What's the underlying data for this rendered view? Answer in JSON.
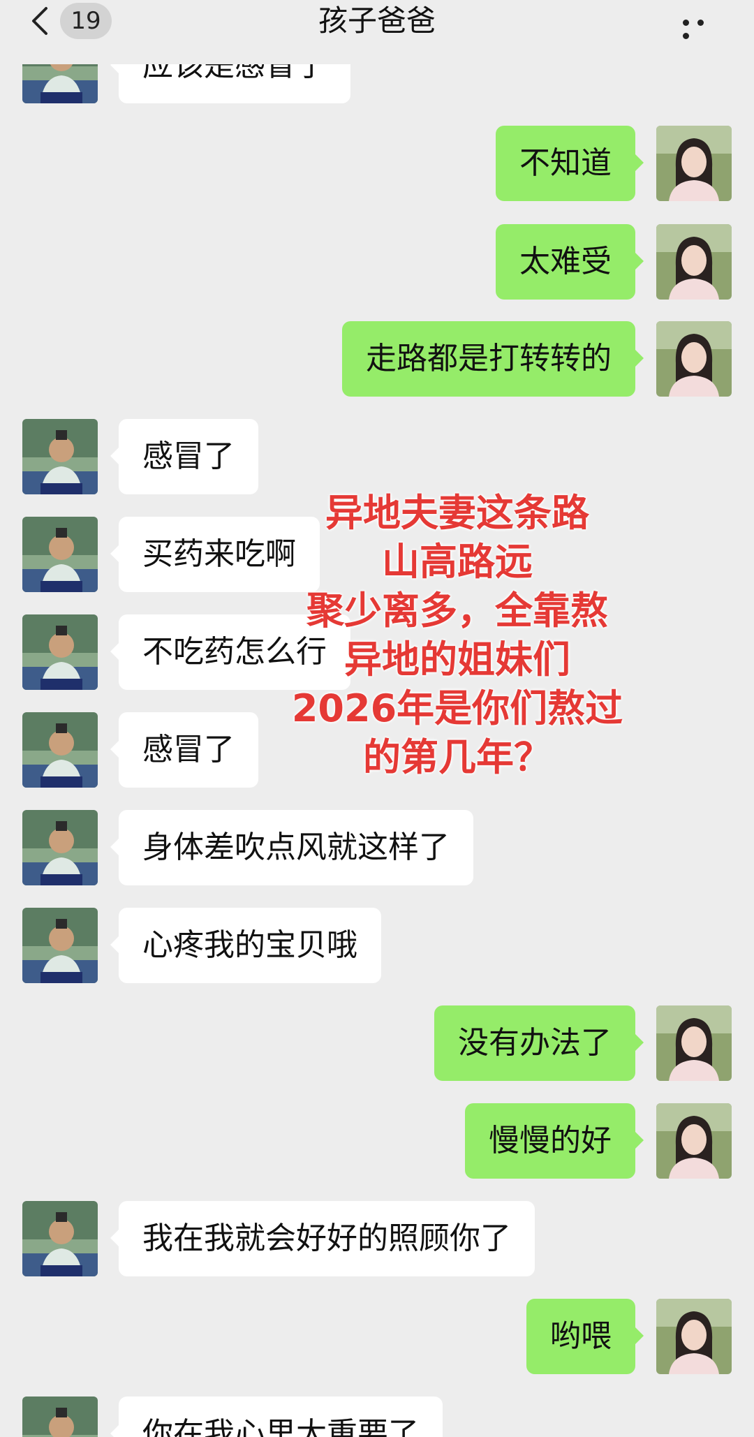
{
  "header": {
    "unread_count": "19",
    "title": "孩子爸爸"
  },
  "messages": [
    {
      "side": "left",
      "text": "应该是感冒了"
    },
    {
      "side": "right",
      "text": "不知道"
    },
    {
      "side": "right",
      "text": "太难受"
    },
    {
      "side": "right",
      "text": "走路都是打转转的"
    },
    {
      "side": "left",
      "text": "感冒了"
    },
    {
      "side": "left",
      "text": "买药来吃啊"
    },
    {
      "side": "left",
      "text": "不吃药怎么行"
    },
    {
      "side": "left",
      "text": "感冒了"
    },
    {
      "side": "left",
      "text": "身体差吹点风就这样了"
    },
    {
      "side": "left",
      "text": "心疼我的宝贝哦"
    },
    {
      "side": "right",
      "text": "没有办法了"
    },
    {
      "side": "right",
      "text": "慢慢的好"
    },
    {
      "side": "left",
      "text": "我在我就会好好的照顾你了"
    },
    {
      "side": "right",
      "text": "哟喂"
    },
    {
      "side": "left",
      "text": "你在我心里太重要了"
    }
  ],
  "overlay": {
    "lines": [
      "异地夫妻这条路",
      "山高路远",
      "聚少离多，全靠熬",
      "异地的姐妹们",
      "2026年是你们熬过",
      "的第几年？"
    ]
  },
  "colors": {
    "background": "#ededed",
    "sent_bubble": "#95ec69",
    "received_bubble": "#ffffff",
    "overlay_text": "#e53935"
  }
}
